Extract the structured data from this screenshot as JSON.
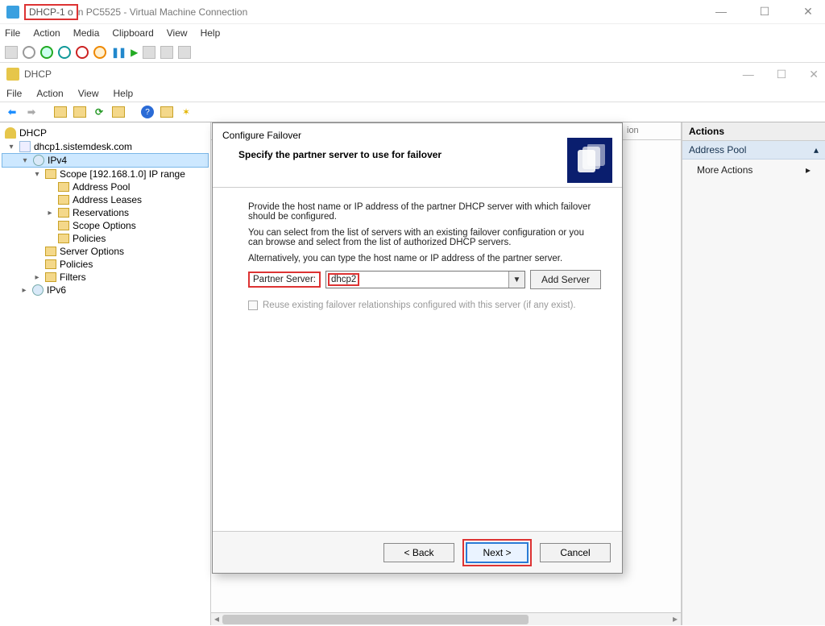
{
  "vm": {
    "title_hl": "DHCP-1 o",
    "title_rest": "n PC5525 - Virtual Machine Connection",
    "menus": [
      "File",
      "Action",
      "Media",
      "Clipboard",
      "View",
      "Help"
    ]
  },
  "dhcp": {
    "title": "DHCP",
    "menus": [
      "File",
      "Action",
      "View",
      "Help"
    ]
  },
  "tree": {
    "root": "DHCP",
    "server": "dhcp1.sistemdesk.com",
    "ipv4": "IPv4",
    "scope": "Scope [192.168.1.0] IP range",
    "address_pool": "Address Pool",
    "address_leases": "Address Leases",
    "reservations": "Reservations",
    "scope_options": "Scope Options",
    "policies": "Policies",
    "server_options": "Server Options",
    "policies2": "Policies",
    "filters": "Filters",
    "ipv6": "IPv6"
  },
  "center": {
    "ion_fragment": "ion"
  },
  "actions": {
    "header": "Actions",
    "section": "Address Pool",
    "more": "More Actions"
  },
  "wizard": {
    "title": "Configure Failover",
    "subtitle": "Specify the partner server to use for failover",
    "p1": "Provide the host name or IP address of the partner DHCP server with which failover should be configured.",
    "p2": "You can select from the list of servers with an existing failover configuration or you can browse and select from the list of authorized DHCP servers.",
    "p3": "Alternatively, you can type the host name or IP address of the partner server.",
    "partner_label": "Partner Server:",
    "partner_value": "dhcp2",
    "add_server": "Add Server",
    "reuse_checkbox": "Reuse existing failover relationships configured with this server (if any exist).",
    "back": "< Back",
    "next": "Next >",
    "cancel": "Cancel"
  }
}
